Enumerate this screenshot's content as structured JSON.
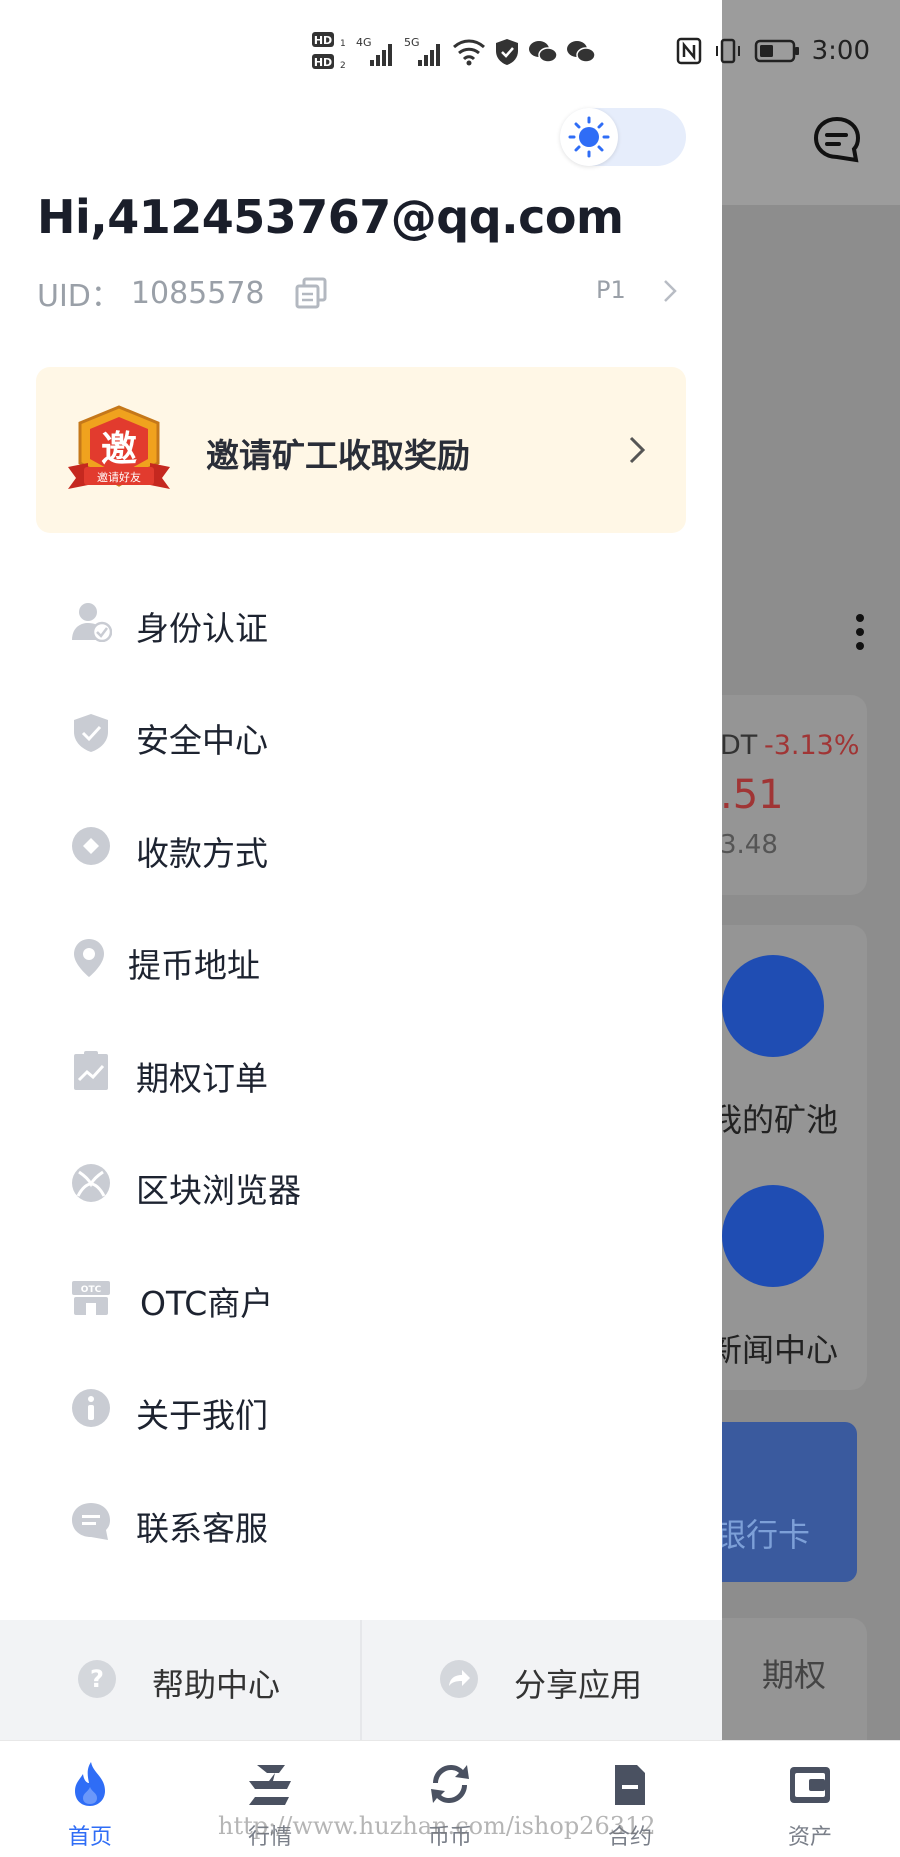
{
  "status_bar": {
    "left_icons": [
      "hd-icon",
      "signal-4g-icon",
      "signal-5g-icon",
      "wifi-icon",
      "shield-icon",
      "wechat-icon",
      "wechat-icon"
    ],
    "time": "3:00",
    "hd1": "HD",
    "hd2": "HD",
    "net1": "4G",
    "net2": "5G"
  },
  "drawer": {
    "theme_toggle": {
      "mode": "light",
      "icon": "sun-icon"
    },
    "greeting": "Hi,412453767@qq.com",
    "uid_label": "UID：",
    "uid_value": "1085578",
    "level": "P1",
    "invite": {
      "badge_text": "邀",
      "badge_ribbon": "邀请好友",
      "label": "邀请矿工收取奖励"
    },
    "menu": [
      {
        "label": "身份认证",
        "icon": "user-verified-icon"
      },
      {
        "label": "安全中心",
        "icon": "shield-check-icon"
      },
      {
        "label": "收款方式",
        "icon": "payment-icon"
      },
      {
        "label": "提币地址",
        "icon": "location-pin-icon"
      },
      {
        "label": "期权订单",
        "icon": "chart-clipboard-icon"
      },
      {
        "label": "区块浏览器",
        "icon": "xbox-icon"
      },
      {
        "label": "OTC商户",
        "icon": "otc-store-icon"
      },
      {
        "label": "关于我们",
        "icon": "info-icon"
      },
      {
        "label": "联系客服",
        "icon": "chat-icon"
      }
    ],
    "bottom_actions": [
      {
        "label": "帮助中心",
        "icon": "help-icon"
      },
      {
        "label": "分享应用",
        "icon": "share-icon"
      }
    ]
  },
  "background_page": {
    "ticker_symbol": "DT",
    "ticker_change": "-3.13%",
    "ticker_price": ".51",
    "ticker_sub": "3.48",
    "tile1_label": "我的矿池",
    "tile2_label": "新闻中心",
    "banner_text": "银行卡",
    "options_label": "期权"
  },
  "tabbar": {
    "tabs": [
      {
        "label": "首页",
        "icon": "flame-icon",
        "active": true
      },
      {
        "label": "行情",
        "icon": "market-icon",
        "active": false
      },
      {
        "label": "币币",
        "icon": "exchange-icon",
        "active": false
      },
      {
        "label": "合约",
        "icon": "contract-icon",
        "active": false
      },
      {
        "label": "资产",
        "icon": "wallet-icon",
        "active": false
      }
    ]
  },
  "watermark": "http://www.huzhan.com/ishop26312",
  "colors": {
    "accent": "#2f6df6",
    "invite_bg": "#fff7e6",
    "negative": "#d64545",
    "icon_gray": "#c9ccd3"
  }
}
